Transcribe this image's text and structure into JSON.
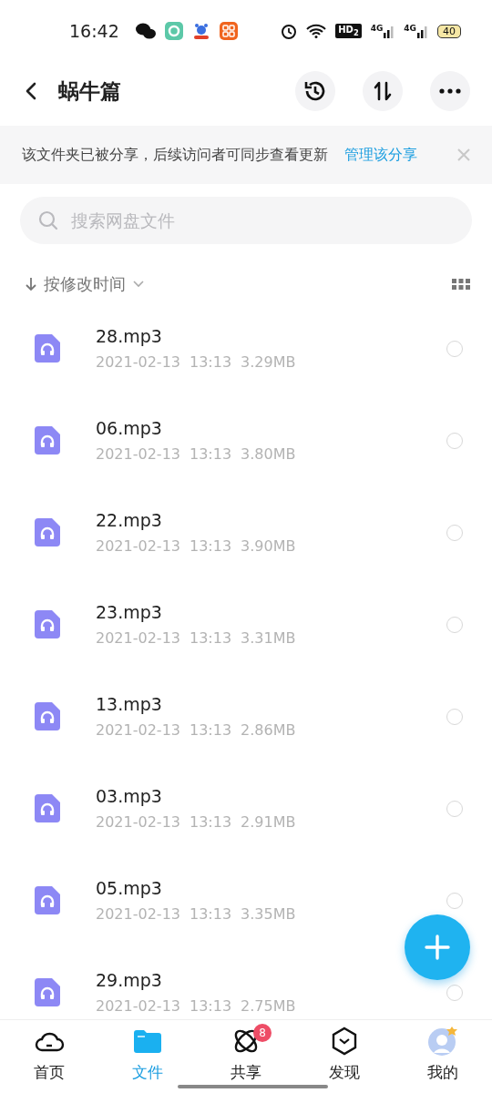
{
  "status_bar": {
    "time": "16:42",
    "hd": "HD$_{2}$",
    "networks": [
      "4G",
      "4G"
    ],
    "battery": "40"
  },
  "header": {
    "title": "蜗牛篇"
  },
  "share_notice": {
    "text": "该文件夹已被分享，后续访问者可同步查看更新",
    "link": "管理该分享"
  },
  "search": {
    "placeholder": "搜索网盘文件"
  },
  "sort": {
    "label": "按修改时间"
  },
  "files": [
    {
      "name": "28.mp3",
      "date": "2021-02-13",
      "time": "13:13",
      "size": "3.29MB",
      "selected": false
    },
    {
      "name": "06.mp3",
      "date": "2021-02-13",
      "time": "13:13",
      "size": "3.80MB",
      "selected": false
    },
    {
      "name": "22.mp3",
      "date": "2021-02-13",
      "time": "13:13",
      "size": "3.90MB",
      "selected": false
    },
    {
      "name": "23.mp3",
      "date": "2021-02-13",
      "time": "13:13",
      "size": "3.31MB",
      "selected": false
    },
    {
      "name": "13.mp3",
      "date": "2021-02-13",
      "time": "13:13",
      "size": "2.86MB",
      "selected": false
    },
    {
      "name": "03.mp3",
      "date": "2021-02-13",
      "time": "13:13",
      "size": "2.91MB",
      "selected": false
    },
    {
      "name": "05.mp3",
      "date": "2021-02-13",
      "time": "13:13",
      "size": "3.35MB",
      "selected": false
    },
    {
      "name": "29.mp3",
      "date": "2021-02-13",
      "time": "13:13",
      "size": "2.75MB",
      "selected": false
    }
  ],
  "tabs": [
    {
      "kind": "home",
      "label": "首页",
      "selected": false
    },
    {
      "kind": "files",
      "label": "文件",
      "selected": true
    },
    {
      "kind": "share",
      "label": "共享",
      "selected": false,
      "badge": "8"
    },
    {
      "kind": "discover",
      "label": "发现",
      "selected": false
    },
    {
      "kind": "me",
      "label": "我的",
      "selected": false
    }
  ]
}
